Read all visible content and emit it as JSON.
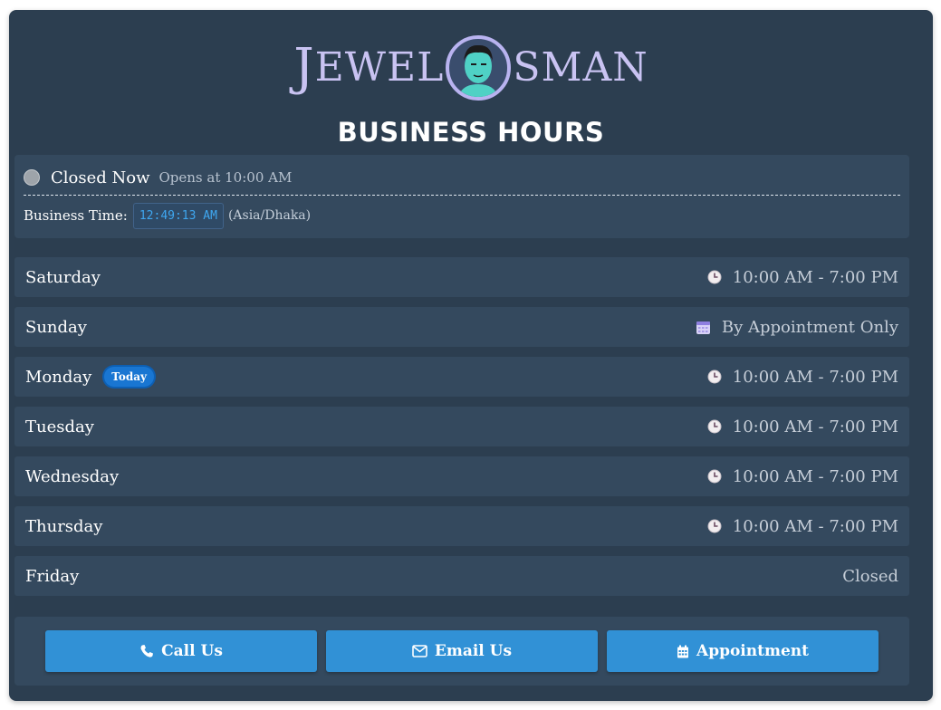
{
  "brand": {
    "name_part1": "JEWEL",
    "name_part2": "OSMAN"
  },
  "header": {
    "title": "BUSINESS HOURS"
  },
  "status": {
    "state": "Closed Now",
    "next_open": "Opens at 10:00 AM",
    "time_label": "Business Time:",
    "clock": "12:49:13 AM",
    "timezone": "(Asia/Dhaka)",
    "indicator_color": "#9ea4aa"
  },
  "days": [
    {
      "name": "Saturday",
      "hours": "10:00 AM - 7:00 PM",
      "icon": "clock-icon"
    },
    {
      "name": "Sunday",
      "hours": "By Appointment Only",
      "icon": "calendar-icon"
    },
    {
      "name": "Monday",
      "hours": "10:00 AM - 7:00 PM",
      "icon": "clock-icon",
      "badge": "Today"
    },
    {
      "name": "Tuesday",
      "hours": "10:00 AM - 7:00 PM",
      "icon": "clock-icon"
    },
    {
      "name": "Wednesday",
      "hours": "10:00 AM - 7:00 PM",
      "icon": "clock-icon"
    },
    {
      "name": "Thursday",
      "hours": "10:00 AM - 7:00 PM",
      "icon": "clock-icon"
    },
    {
      "name": "Friday",
      "hours": "Closed",
      "icon": ""
    }
  ],
  "actions": {
    "call_label": "Call Us",
    "email_label": "Email Us",
    "appointment_label": "Appointment"
  },
  "colors": {
    "card_bg": "#2c3e50",
    "row_bg": "#34495e",
    "button_bg": "#3191d6",
    "badge_bg": "#1976d2",
    "logo": "#c9c3f2"
  }
}
